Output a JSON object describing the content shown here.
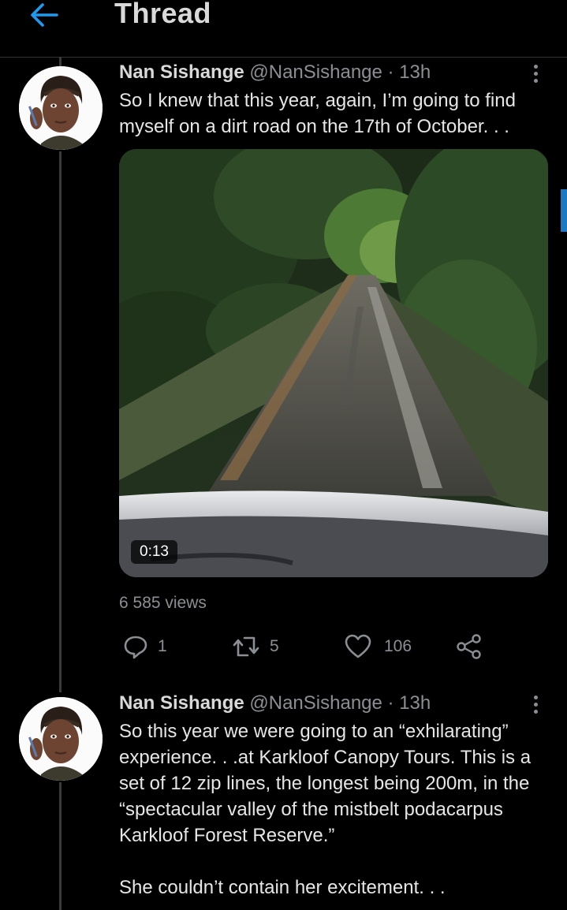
{
  "header": {
    "title": "Thread"
  },
  "tweets": [
    {
      "name": "Nan Sishange",
      "handle": "@NanSishange",
      "time": "· 13h",
      "text": "So I knew that this year, again, I’m going to find myself on a dirt road on the 17th of October. . .",
      "video_duration": "0:13",
      "views": "6 585 views",
      "replies": "1",
      "retweets": "5",
      "likes": "106"
    },
    {
      "name": "Nan Sishange",
      "handle": "@NanSishange",
      "time": "· 13h",
      "text": "So this year we were going to an “exhilarating” experience. . .at Karkloof Canopy Tours. This is a set of 12 zip lines, the longest being 200m, in the “spectacular valley of the mistbelt podacarpus Karkloof Forest Reserve.”\n\nShe couldn’t contain her excitement. . ."
    }
  ],
  "colors": {
    "accent": "#1d9bf0",
    "background": "#000000",
    "secondary_text": "#8b8f93"
  },
  "icons": [
    "back-arrow-icon",
    "more-vertical-icon",
    "reply-icon",
    "retweet-icon",
    "like-icon",
    "share-icon"
  ]
}
